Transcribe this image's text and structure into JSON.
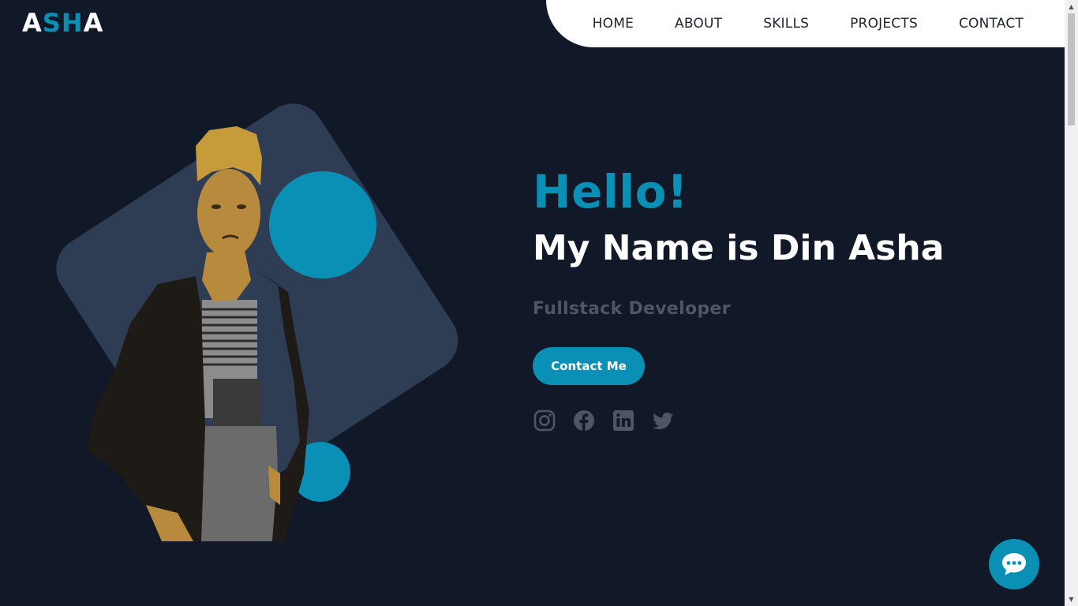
{
  "brand": {
    "logo_part1": "A",
    "logo_part2": "SH",
    "logo_part3": "A"
  },
  "nav": {
    "items": [
      {
        "label": "HOME"
      },
      {
        "label": "ABOUT"
      },
      {
        "label": "SKILLS"
      },
      {
        "label": "PROJECTS"
      },
      {
        "label": "CONTACT"
      }
    ]
  },
  "hero": {
    "greeting": "Hello!",
    "name": "My Name is Din Asha",
    "role": "Fullstack Developer",
    "cta_label": "Contact Me",
    "photo": "profile-photo"
  },
  "socials": [
    {
      "icon": "instagram-icon"
    },
    {
      "icon": "facebook-icon"
    },
    {
      "icon": "linkedin-icon"
    },
    {
      "icon": "twitter-icon"
    }
  ],
  "chat": {
    "icon": "chat-bubble-icon"
  },
  "colors": {
    "background": "#111827",
    "accent": "#0a8fb5",
    "card": "#2f3d54",
    "muted": "#4d5566",
    "nav_bg": "#ffffff"
  }
}
